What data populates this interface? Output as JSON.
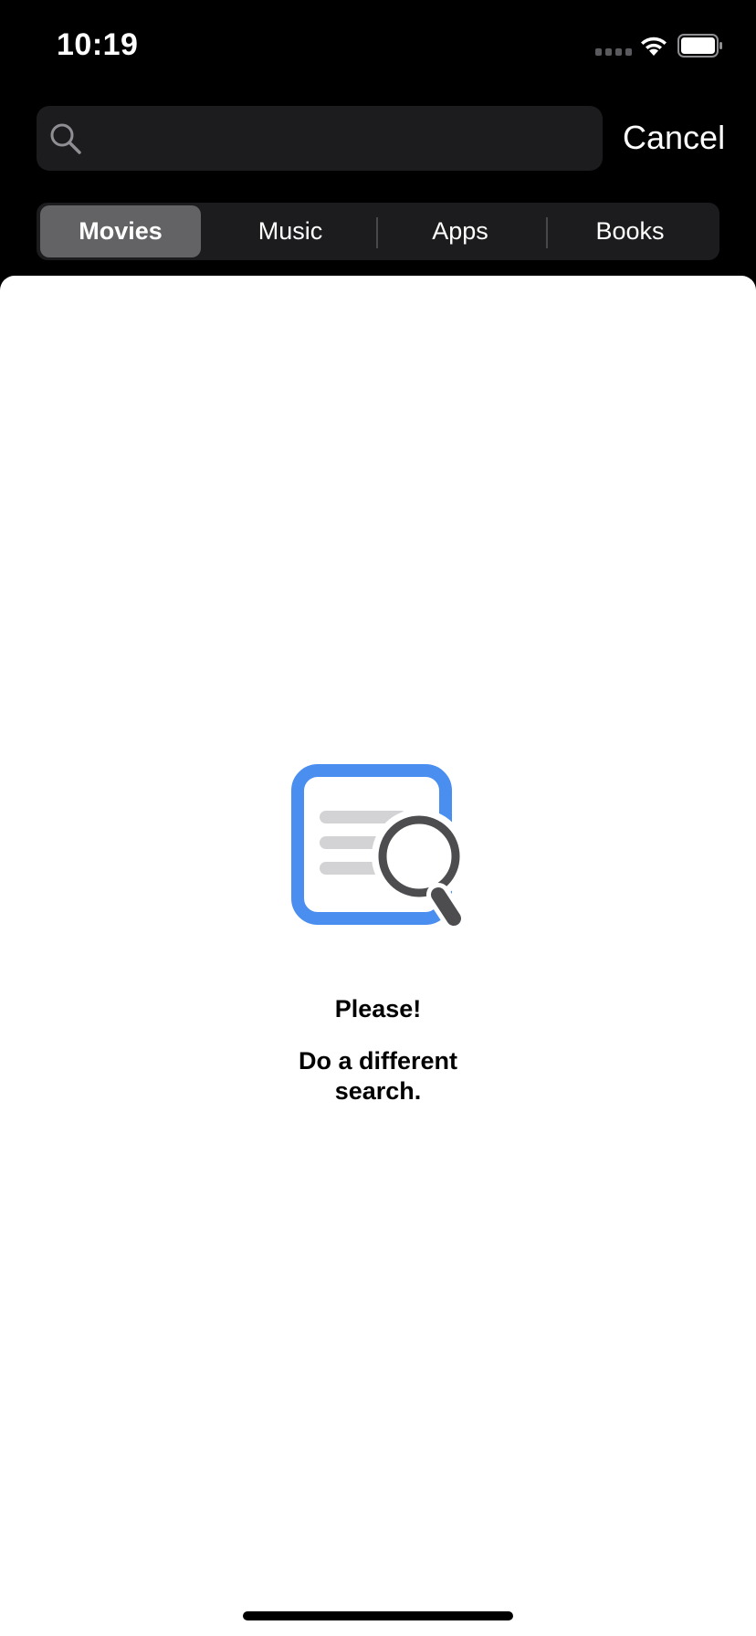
{
  "status_bar": {
    "time": "10:19",
    "icons": [
      "signal-icon",
      "wifi-icon",
      "battery-icon"
    ]
  },
  "search": {
    "value": "",
    "placeholder": "",
    "icon": "search-icon",
    "cancel_label": "Cancel"
  },
  "tabs": [
    {
      "label": "Movies",
      "selected": true
    },
    {
      "label": "Music",
      "selected": false
    },
    {
      "label": "Apps",
      "selected": false
    },
    {
      "label": "Books",
      "selected": false
    }
  ],
  "empty_state": {
    "icon": "document-search-icon",
    "title": "Please!",
    "message": "Do a different search."
  },
  "colors": {
    "background": "#000000",
    "search_field": "#1c1c1e",
    "segment_selected": "#636366",
    "content": "#ffffff",
    "illustration_accent": "#4a8ef0"
  }
}
